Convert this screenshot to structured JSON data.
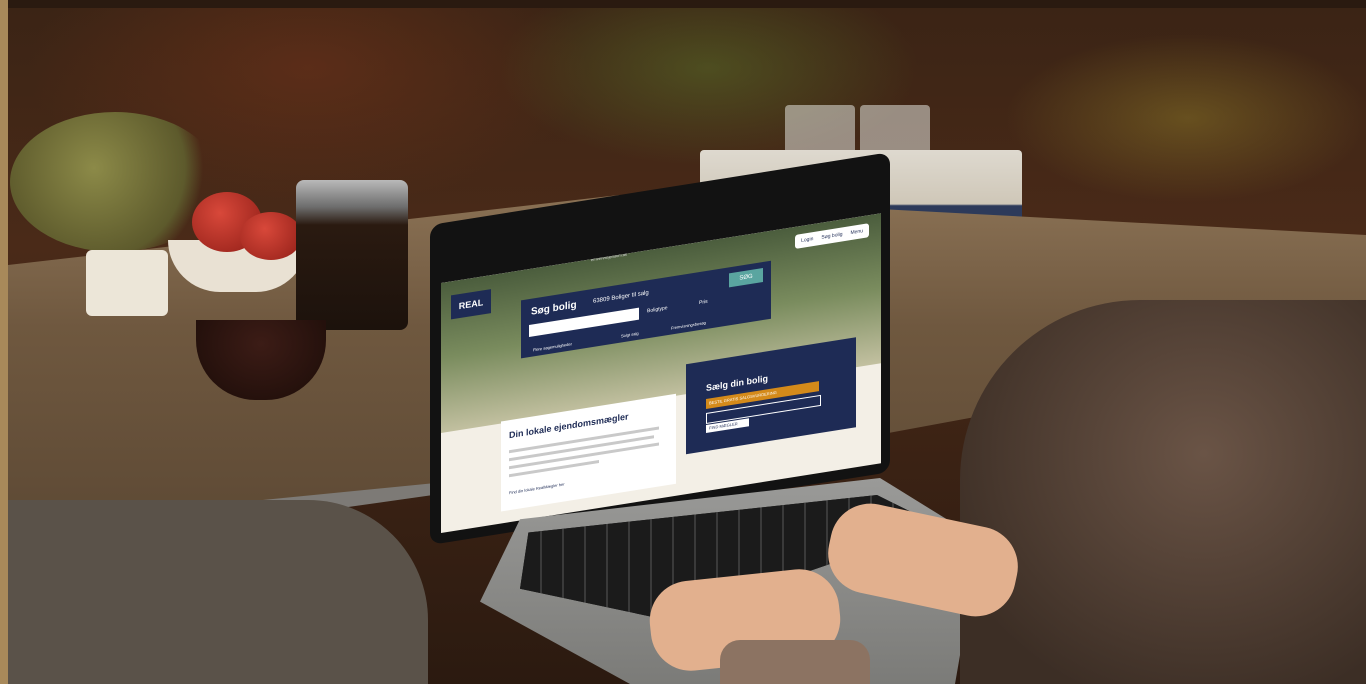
{
  "scene": {
    "description_tag": "photo",
    "colors": {
      "brand_navy": "#1e2b55",
      "brand_teal": "#5aa5a0",
      "brand_orange": "#d48a1a"
    }
  },
  "website": {
    "url": "erhvervsejendom.dk",
    "logo": "REAL",
    "topbar": {
      "login": "Login",
      "search": "Søg bolig",
      "menu": "Menu"
    },
    "search": {
      "title": "Søg bolig",
      "count": "63809 Boliger til salg",
      "property_type": "Boligtype",
      "price": "Pris",
      "button": "SØG",
      "more_options": "Flere søgemuligheder",
      "sold": "Solgt salg",
      "open_house": "Fremvisningsbesøg"
    },
    "agent_card": {
      "title": "Din lokale ejendomsmægler",
      "link": "Find din lokale RealMægler her"
    },
    "sell": {
      "title": "Sælg din bolig",
      "cta": "BESTIL GRATIS SALGSVURDERING",
      "button": "FIND MÆGLER"
    }
  }
}
